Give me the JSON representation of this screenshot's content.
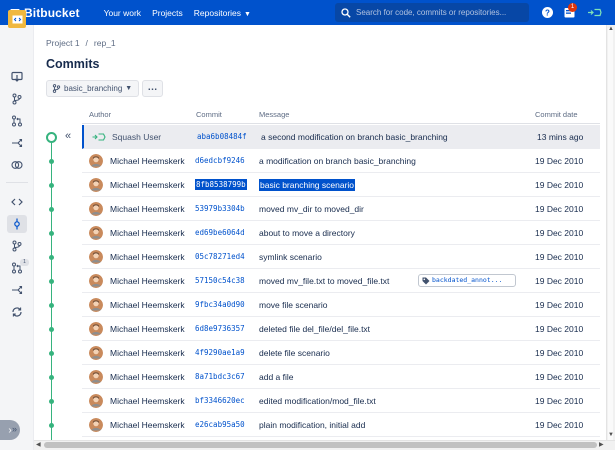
{
  "topnav": {
    "logo_text": "Bitbucket",
    "links": [
      "Your work",
      "Projects",
      "Repositories"
    ],
    "search_placeholder": "Search for code, commits or repositories...",
    "notification_count": "1"
  },
  "breadcrumb": {
    "project": "Project 1",
    "separator": "/",
    "repo": "rep_1"
  },
  "page_title": "Commits",
  "branch_selector": {
    "label": "basic_branching"
  },
  "more_button": "…",
  "collapse_button": "«",
  "sidebar": {
    "items": [
      "source-icon",
      "branches-icon",
      "pull-requests-icon",
      "forks-icon",
      "compare-icon",
      "code-icon",
      "commits-icon",
      "branches-icon",
      "pull-requests-icon",
      "forks-icon",
      "sync-icon"
    ],
    "active_item": "commits-icon",
    "pr_count": "1",
    "expand_label": "»"
  },
  "table": {
    "headers": {
      "author": "Author",
      "commit": "Commit",
      "message": "Message",
      "date": "Commit date"
    },
    "rows": [
      {
        "author": "Squash User",
        "commit": "aba6b08484f",
        "message": "a second modification on branch basic_branching",
        "date": "13 mins ago",
        "current": true
      },
      {
        "author": "Michael Heemskerk",
        "commit": "d6edcbf9246",
        "message": "a modification on branch basic_branching",
        "date": "19 Dec 2010"
      },
      {
        "author": "Michael Heemskerk",
        "commit": "8fb8538799b",
        "message": "basic branching scenario",
        "date": "19 Dec 2010",
        "selected": true
      },
      {
        "author": "Michael Heemskerk",
        "commit": "53979b3304b",
        "message": "moved mv_dir to moved_dir",
        "date": "19 Dec 2010"
      },
      {
        "author": "Michael Heemskerk",
        "commit": "ed69be6064d",
        "message": "about to move a directory",
        "date": "19 Dec 2010"
      },
      {
        "author": "Michael Heemskerk",
        "commit": "05c78271ed4",
        "message": "symlink scenario",
        "date": "19 Dec 2010"
      },
      {
        "author": "Michael Heemskerk",
        "commit": "57150c54c38",
        "message": "moved mv_file.txt to moved_file.txt",
        "date": "19 Dec 2010",
        "tag": "backdated_annot..."
      },
      {
        "author": "Michael Heemskerk",
        "commit": "9fbc34a0d90",
        "message": "move file scenario",
        "date": "19 Dec 2010"
      },
      {
        "author": "Michael Heemskerk",
        "commit": "6d8e9736357",
        "message": "deleted file del_file/del_file.txt",
        "date": "19 Dec 2010"
      },
      {
        "author": "Michael Heemskerk",
        "commit": "4f9290ae1a9",
        "message": "delete file scenario",
        "date": "19 Dec 2010"
      },
      {
        "author": "Michael Heemskerk",
        "commit": "8a71bdc3c67",
        "message": "add a file",
        "date": "19 Dec 2010"
      },
      {
        "author": "Michael Heemskerk",
        "commit": "bf3346620ec",
        "message": "edited modification/mod_file.txt",
        "date": "19 Dec 2010"
      },
      {
        "author": "Michael Heemskerk",
        "commit": "e26cab95a50",
        "message": "plain modification, initial add",
        "date": "19 Dec 2010"
      }
    ]
  },
  "colors": {
    "brand": "#0052cc",
    "graph": "#36b37e",
    "link": "#0052cc"
  }
}
